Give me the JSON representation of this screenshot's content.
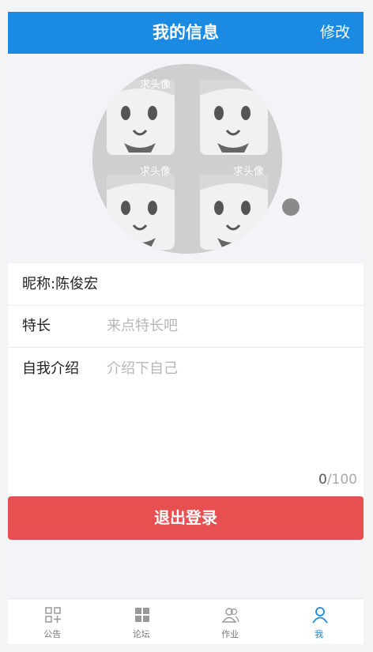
{
  "header": {
    "title": "我的信息",
    "edit_label": "修改"
  },
  "avatar": {
    "watermark": "求头像"
  },
  "form": {
    "nickname_label": "昵称:",
    "nickname_value": "陈俊宏",
    "specialty_label": "特长",
    "specialty_placeholder": "来点特长吧",
    "intro_label": "自我介绍",
    "intro_placeholder": "介绍下自己",
    "intro_count": "0",
    "intro_max": "/100"
  },
  "logout_label": "退出登录",
  "tabs": [
    {
      "label": "公告",
      "icon": "notice-icon"
    },
    {
      "label": "论坛",
      "icon": "forum-icon"
    },
    {
      "label": "作业",
      "icon": "homework-icon"
    },
    {
      "label": "我",
      "icon": "me-icon",
      "active": true
    }
  ],
  "colors": {
    "primary": "#1a8ae3",
    "danger": "#e84f50"
  }
}
